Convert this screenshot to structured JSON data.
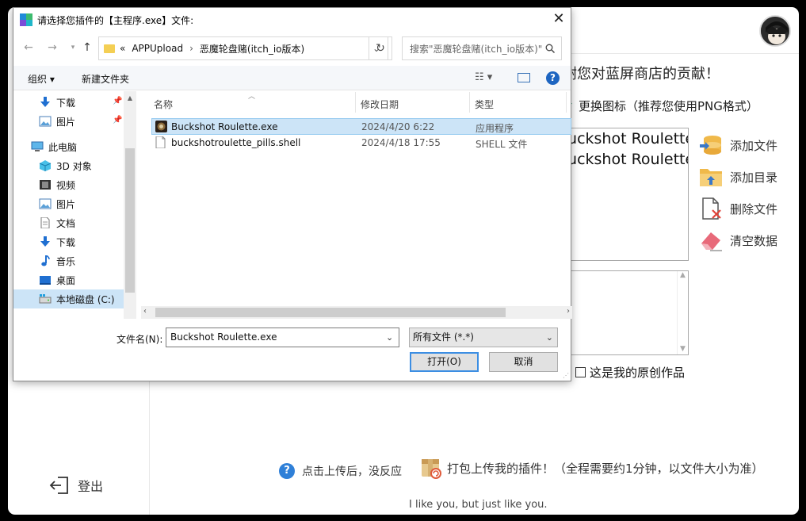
{
  "app": {
    "thanks_text": "谢您对蓝屏商店的贡献！",
    "change_icon_label": "更换图标（推荐您使用PNG格式）",
    "file_entries": [
      "Buckshot Roulette\\",
      "Buckshot Roulette\\"
    ],
    "actions": {
      "add_file": "添加文件",
      "add_folder": "添加目录",
      "delete_file": "删除文件",
      "clear_data": "清空数据"
    },
    "original_work_label": "这是我的原创作品",
    "no_response_label": "点击上传后，没反应",
    "pack_upload_label": "打包上传我的插件！（全程需要约1分钟，以文件大小为准）",
    "logout_label": "登出",
    "tagline": "I like you, but just like you."
  },
  "dialog": {
    "title": "请选择您插件的【主程序.exe】文件:",
    "close_glyph": "✕",
    "breadcrumb": {
      "prefix": "«",
      "parts": [
        "APPUpload",
        "恶魔轮盘赌(itch_io版本)"
      ]
    },
    "search_placeholder": "搜索\"恶魔轮盘赌(itch_io版本)\"",
    "toolbar": {
      "organize": "组织 ▾",
      "new_folder": "新建文件夹"
    },
    "tree": [
      {
        "label": "下载",
        "icon": "download-arrow-icon",
        "pinned": true
      },
      {
        "label": "图片",
        "icon": "pictures-icon",
        "pinned": true
      },
      {
        "label": "此电脑",
        "icon": "this-pc-icon",
        "pinned": false
      },
      {
        "label": "3D 对象",
        "icon": "3d-objects-icon",
        "pinned": false
      },
      {
        "label": "视频",
        "icon": "videos-icon",
        "pinned": false
      },
      {
        "label": "图片",
        "icon": "pictures-icon",
        "pinned": false
      },
      {
        "label": "文档",
        "icon": "documents-icon",
        "pinned": false
      },
      {
        "label": "下载",
        "icon": "download-arrow-icon",
        "pinned": false
      },
      {
        "label": "音乐",
        "icon": "music-icon",
        "pinned": false
      },
      {
        "label": "桌面",
        "icon": "desktop-icon",
        "pinned": false
      },
      {
        "label": "本地磁盘 (C:)",
        "icon": "local-disk-icon",
        "pinned": false
      }
    ],
    "columns": {
      "name": "名称",
      "modified": "修改日期",
      "type": "类型"
    },
    "files": [
      {
        "name": "Buckshot Roulette.exe",
        "modified": "2024/4/20 6:22",
        "type": "应用程序",
        "selected": true
      },
      {
        "name": "buckshotroulette_pills.shell",
        "modified": "2024/4/18 17:55",
        "type": "SHELL 文件",
        "selected": false
      }
    ],
    "filename_label": "文件名(N):",
    "filename_value": "Buckshot Roulette.exe",
    "filetype_value": "所有文件  (*.*)",
    "open_label": "打开(O)",
    "cancel_label": "取消"
  },
  "colors": {
    "selection": "#cce4f7",
    "accent_blue": "#1d65c1",
    "folder_yellow": "#f4cf54"
  }
}
